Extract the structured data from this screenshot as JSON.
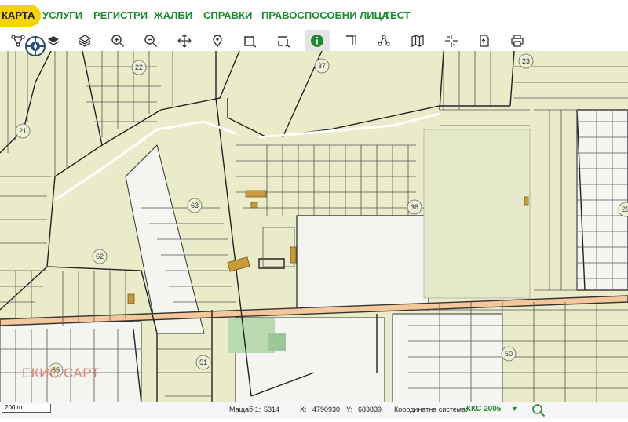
{
  "nav": {
    "items": [
      {
        "label": "КАРТА",
        "active": true
      },
      {
        "label": "УСЛУГИ"
      },
      {
        "label": "РЕГИСТРИ"
      },
      {
        "label": "ЖАЛБИ"
      },
      {
        "label": "СПРАВКИ"
      },
      {
        "label": "ПРАВОСПОСОБНИ ЛИЦА"
      },
      {
        "label": "ТЕСТ"
      }
    ]
  },
  "toolbar": {
    "tools": [
      "route-icon",
      "layers-icon",
      "zoom-in-icon",
      "zoom-out-icon",
      "pan-icon",
      "location-pin-icon",
      "select-rectangle-icon",
      "select-area-icon",
      "info-icon",
      "measure-icon",
      "share-nodes-icon",
      "map-icon",
      "crosshair-icon",
      "export-icon",
      "print-icon"
    ]
  },
  "map": {
    "parcel_labels": [
      "22",
      "37",
      "23",
      "21",
      "63",
      "38",
      "29",
      "62",
      "51",
      "50",
      "55"
    ],
    "watermark": "ЕКИС САРТ",
    "colors": {
      "parcel": "#e9ebc9",
      "road": "#f5c79a",
      "building": "#c89a3a",
      "green": "#b9d9b0",
      "white_parcel": "#f4f4f0"
    }
  },
  "status": {
    "scale_bar": "200 m",
    "scale_label": "Мащаб 1:",
    "scale_value": "5314",
    "x_label": "X:",
    "x_value": "4790930",
    "y_label": "Y:",
    "y_value": "683839",
    "crs_label": "Координатна система:",
    "crs_value": "ККС 2005"
  }
}
